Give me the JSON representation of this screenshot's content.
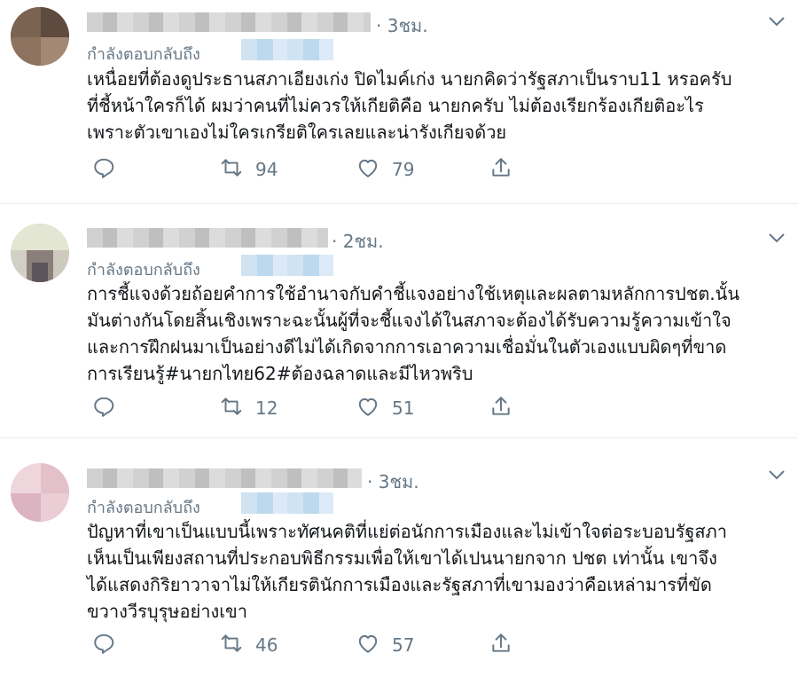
{
  "tweets": [
    {
      "time": "· 3ชม.",
      "replying_to": "กำลังตอบกลับถึง",
      "lines": [
        "เหนื่อยที่ต้องดูประธานสภาเอียงเก่ง ปิดไมค์เก่ง นายกคิดว่ารัฐสภาเป็นราบ11 หรอครับ",
        "ที่ชี้หน้าใครก็ได้ ผมว่าคนที่ไม่ควรให้เกียติคือ นายกครับ ไม่ต้องเรียกร้องเกียติอะไร",
        "เพราะตัวเขาเองไม่ใครเกรียติใครเลยและน่ารังเกียจด้วย"
      ],
      "retweets": "94",
      "likes": "79"
    },
    {
      "time": "· 2ชม.",
      "replying_to": "กำลังตอบกลับถึง",
      "lines": [
        "การชี้แจงด้วยถ้อยคำการใช้อำนาจกับคำชี้แจงอย่างใช้เหตุและผลตามหลักการปชต.นั้น",
        "มันต่างกันโดยสิ้นเชิงเพราะฉะนั้นผู้ที่จะชี้แจงได้ในสภาจะต้องได้รับความรู้ความเข้าใจ",
        "และการฝึกฝนมาเป็นอย่างดีไม่ได้เกิดจากการเอาความเชื่อมั่นในตัวเองแบบผิดๆที่ขาด",
        "การเรียนรู้#นายกไทย62#ต้องฉลาดและมีไหวพริบ"
      ],
      "retweets": "12",
      "likes": "51"
    },
    {
      "time": "· 3ชม.",
      "replying_to": "กำลังตอบกลับถึง",
      "lines": [
        "ปัญหาที่เขาเป็นแบบนี้เพราะทัศนคติที่แย่ต่อนักการเมืองและไม่เข้าใจต่อระบอบรัฐสภา",
        "เห็นเป็นเพียงสถานที่ประกอบพิธีกรรมเพื่อให้เขาได้เปนนายกจาก ปชต เท่านั้น เขาจึง",
        "ได้แสดงกิริยาวาจาไม่ให้เกียรตินักการเมืองและรัฐสภาที่เขามองว่าคือเหล่ามารที่ขัด",
        "ขวางวีรบุรุษอย่างเขา"
      ],
      "retweets": "46",
      "likes": "57"
    }
  ],
  "icons": {
    "reply": "reply-icon",
    "retweet": "retweet-icon",
    "like": "like-icon",
    "share": "share-icon",
    "menu": "chevron-down-icon"
  },
  "colors": {
    "secondary_text": "#657786",
    "icon": "#657786",
    "divider": "#e6ecf0"
  }
}
